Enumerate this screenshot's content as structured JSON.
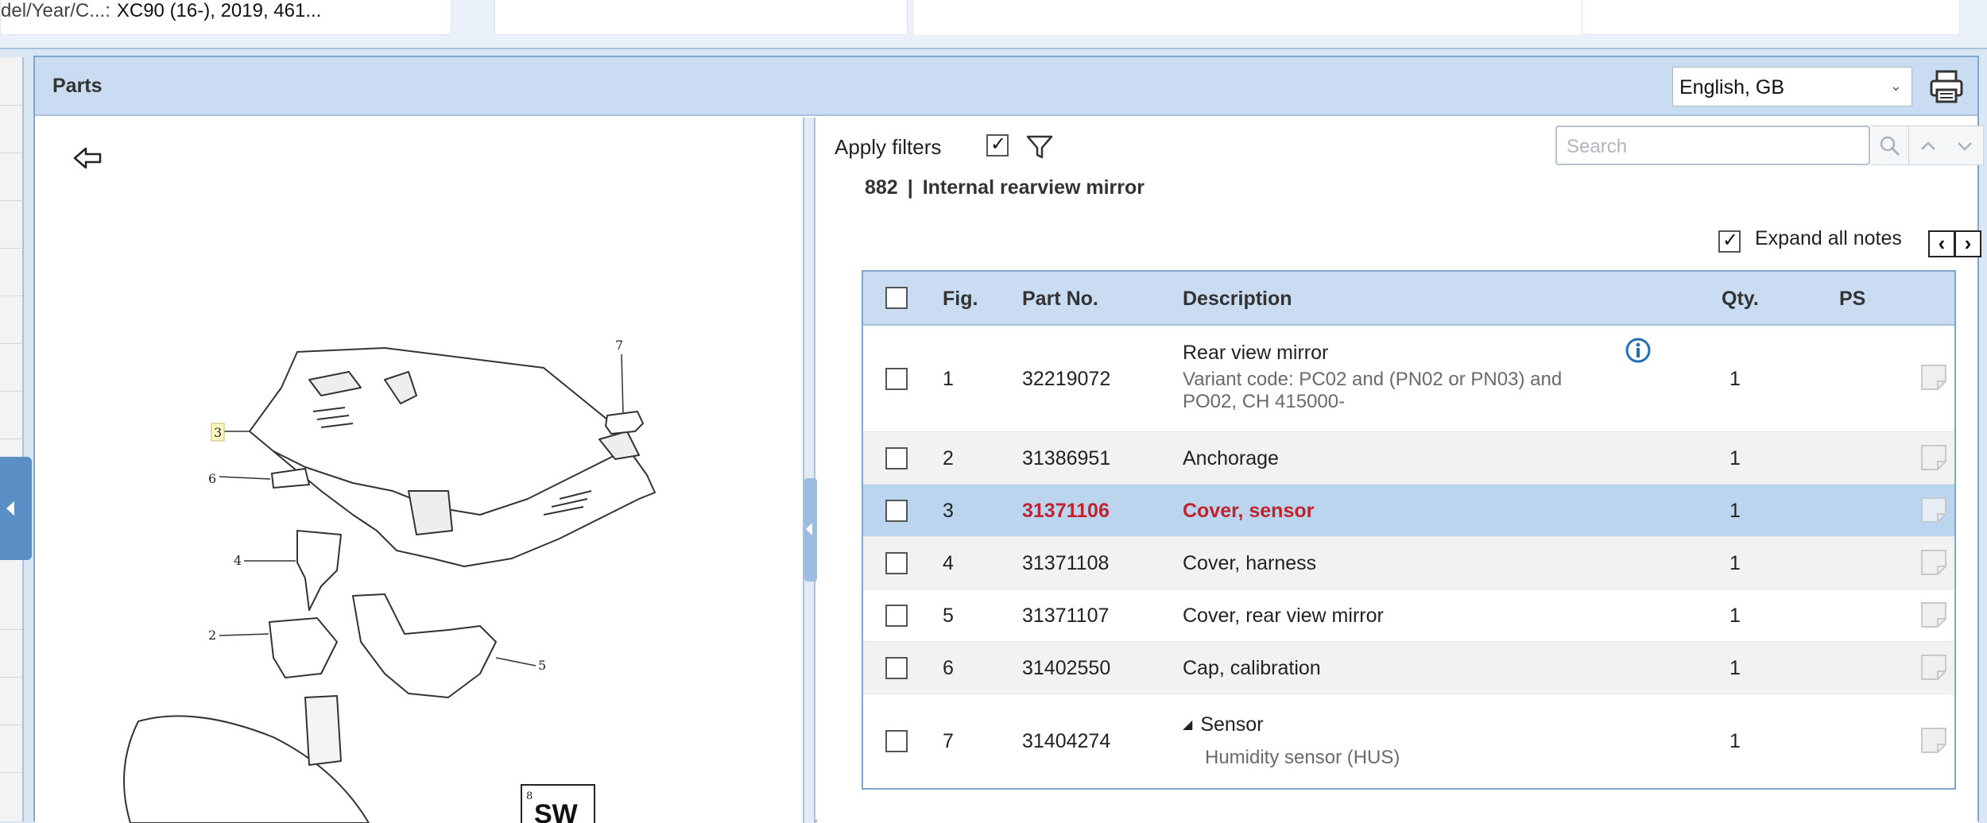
{
  "topbar": {
    "model_label": "del/Year/C...:",
    "model_value": "XC90 (16-), 2019, 461..."
  },
  "panel": {
    "title": "Parts",
    "language": "English, GB",
    "print_icon": "printer-icon"
  },
  "illustration": {
    "back_icon": "arrow-left-outline-icon",
    "callouts": [
      "7",
      "3",
      "6",
      "4",
      "2",
      "5",
      "8"
    ],
    "badge": "SW"
  },
  "list": {
    "apply_filters_label": "Apply filters",
    "apply_filters_checked": true,
    "search_placeholder": "Search",
    "section_number": "882",
    "section_separator": "|",
    "section_title": "Internal rearview mirror",
    "expand_all_label": "Expand all notes",
    "expand_all_checked": true,
    "prev_label": "‹",
    "next_label": "›",
    "columns": {
      "fig": "Fig.",
      "part_no": "Part No.",
      "description": "Description",
      "qty": "Qty.",
      "ps": "PS"
    },
    "rows": [
      {
        "fig": "1",
        "part_no": "32219072",
        "description": "Rear view mirror",
        "note1": "Variant code: PC02 and (PN02 or PN03) and",
        "note2": "PO02, CH 415000-",
        "qty": "1"
      },
      {
        "fig": "2",
        "part_no": "31386951",
        "description": "Anchorage",
        "qty": "1"
      },
      {
        "fig": "3",
        "part_no": "31371106",
        "description": "Cover, sensor",
        "qty": "1",
        "selected": true
      },
      {
        "fig": "4",
        "part_no": "31371108",
        "description": "Cover, harness",
        "qty": "1"
      },
      {
        "fig": "5",
        "part_no": "31371107",
        "description": "Cover, rear view mirror",
        "qty": "1"
      },
      {
        "fig": "6",
        "part_no": "31402550",
        "description": "Cap, calibration",
        "qty": "1"
      },
      {
        "fig": "7",
        "part_no": "31404274",
        "description": "Sensor",
        "note1": "Humidity sensor (HUS)",
        "qty": "1"
      }
    ]
  },
  "colors": {
    "header_bg": "#c9dcf1",
    "selected_row": "#bcd5ef",
    "selected_text": "#c0232c",
    "info_blue": "#1e6fb8"
  }
}
